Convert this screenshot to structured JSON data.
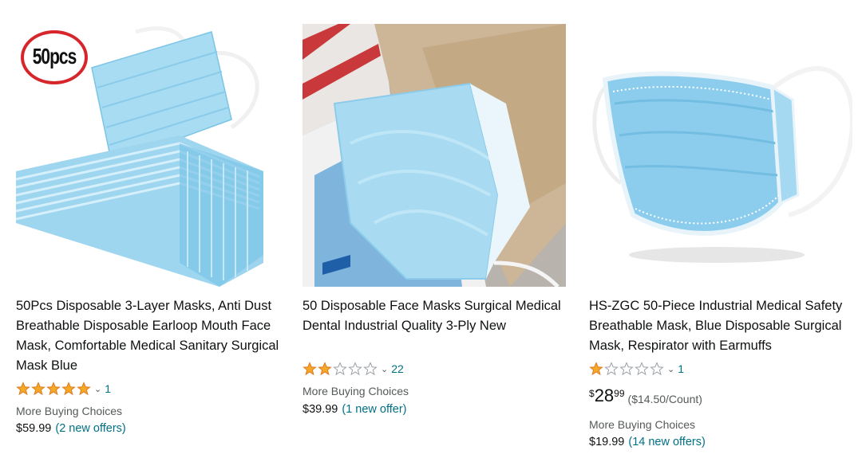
{
  "products": [
    {
      "title": "50Pcs Disposable 3-Layer Masks, Anti Dust Breathable Disposable Earloop Mouth Face Mask, Comfortable Medical Sanitary Surgical Mask Blue",
      "badge": "50pcs",
      "rating_stars": 5,
      "review_count": "1",
      "more_buying_label": "More Buying Choices",
      "offer_price": "$59.99",
      "offer_link": "(2 new offers)"
    },
    {
      "title": "50 Disposable Face Masks Surgical Medical Dental Industrial Quality 3-Ply New",
      "rating_stars": 2,
      "review_count": "22",
      "more_buying_label": "More Buying Choices",
      "offer_price": "$39.99",
      "offer_link": "(1 new offer)"
    },
    {
      "title": "HS-ZGC 50-Piece Industrial Medical Safety Breathable Mask, Blue Disposable Surgical Mask, Respirator with Earmuffs",
      "rating_stars": 1,
      "review_count": "1",
      "price_symbol": "$",
      "price_whole": "28",
      "price_fraction": "99",
      "price_per_unit": "($14.50/Count)",
      "more_buying_label": "More Buying Choices",
      "offer_price": "$19.99",
      "offer_link": "(14 new offers)"
    }
  ],
  "colors": {
    "star_fill": "#f4a826",
    "star_stroke": "#de7921",
    "link": "#007185",
    "mask_blue": "#8fd0ee",
    "badge_red": "#d7262b"
  }
}
